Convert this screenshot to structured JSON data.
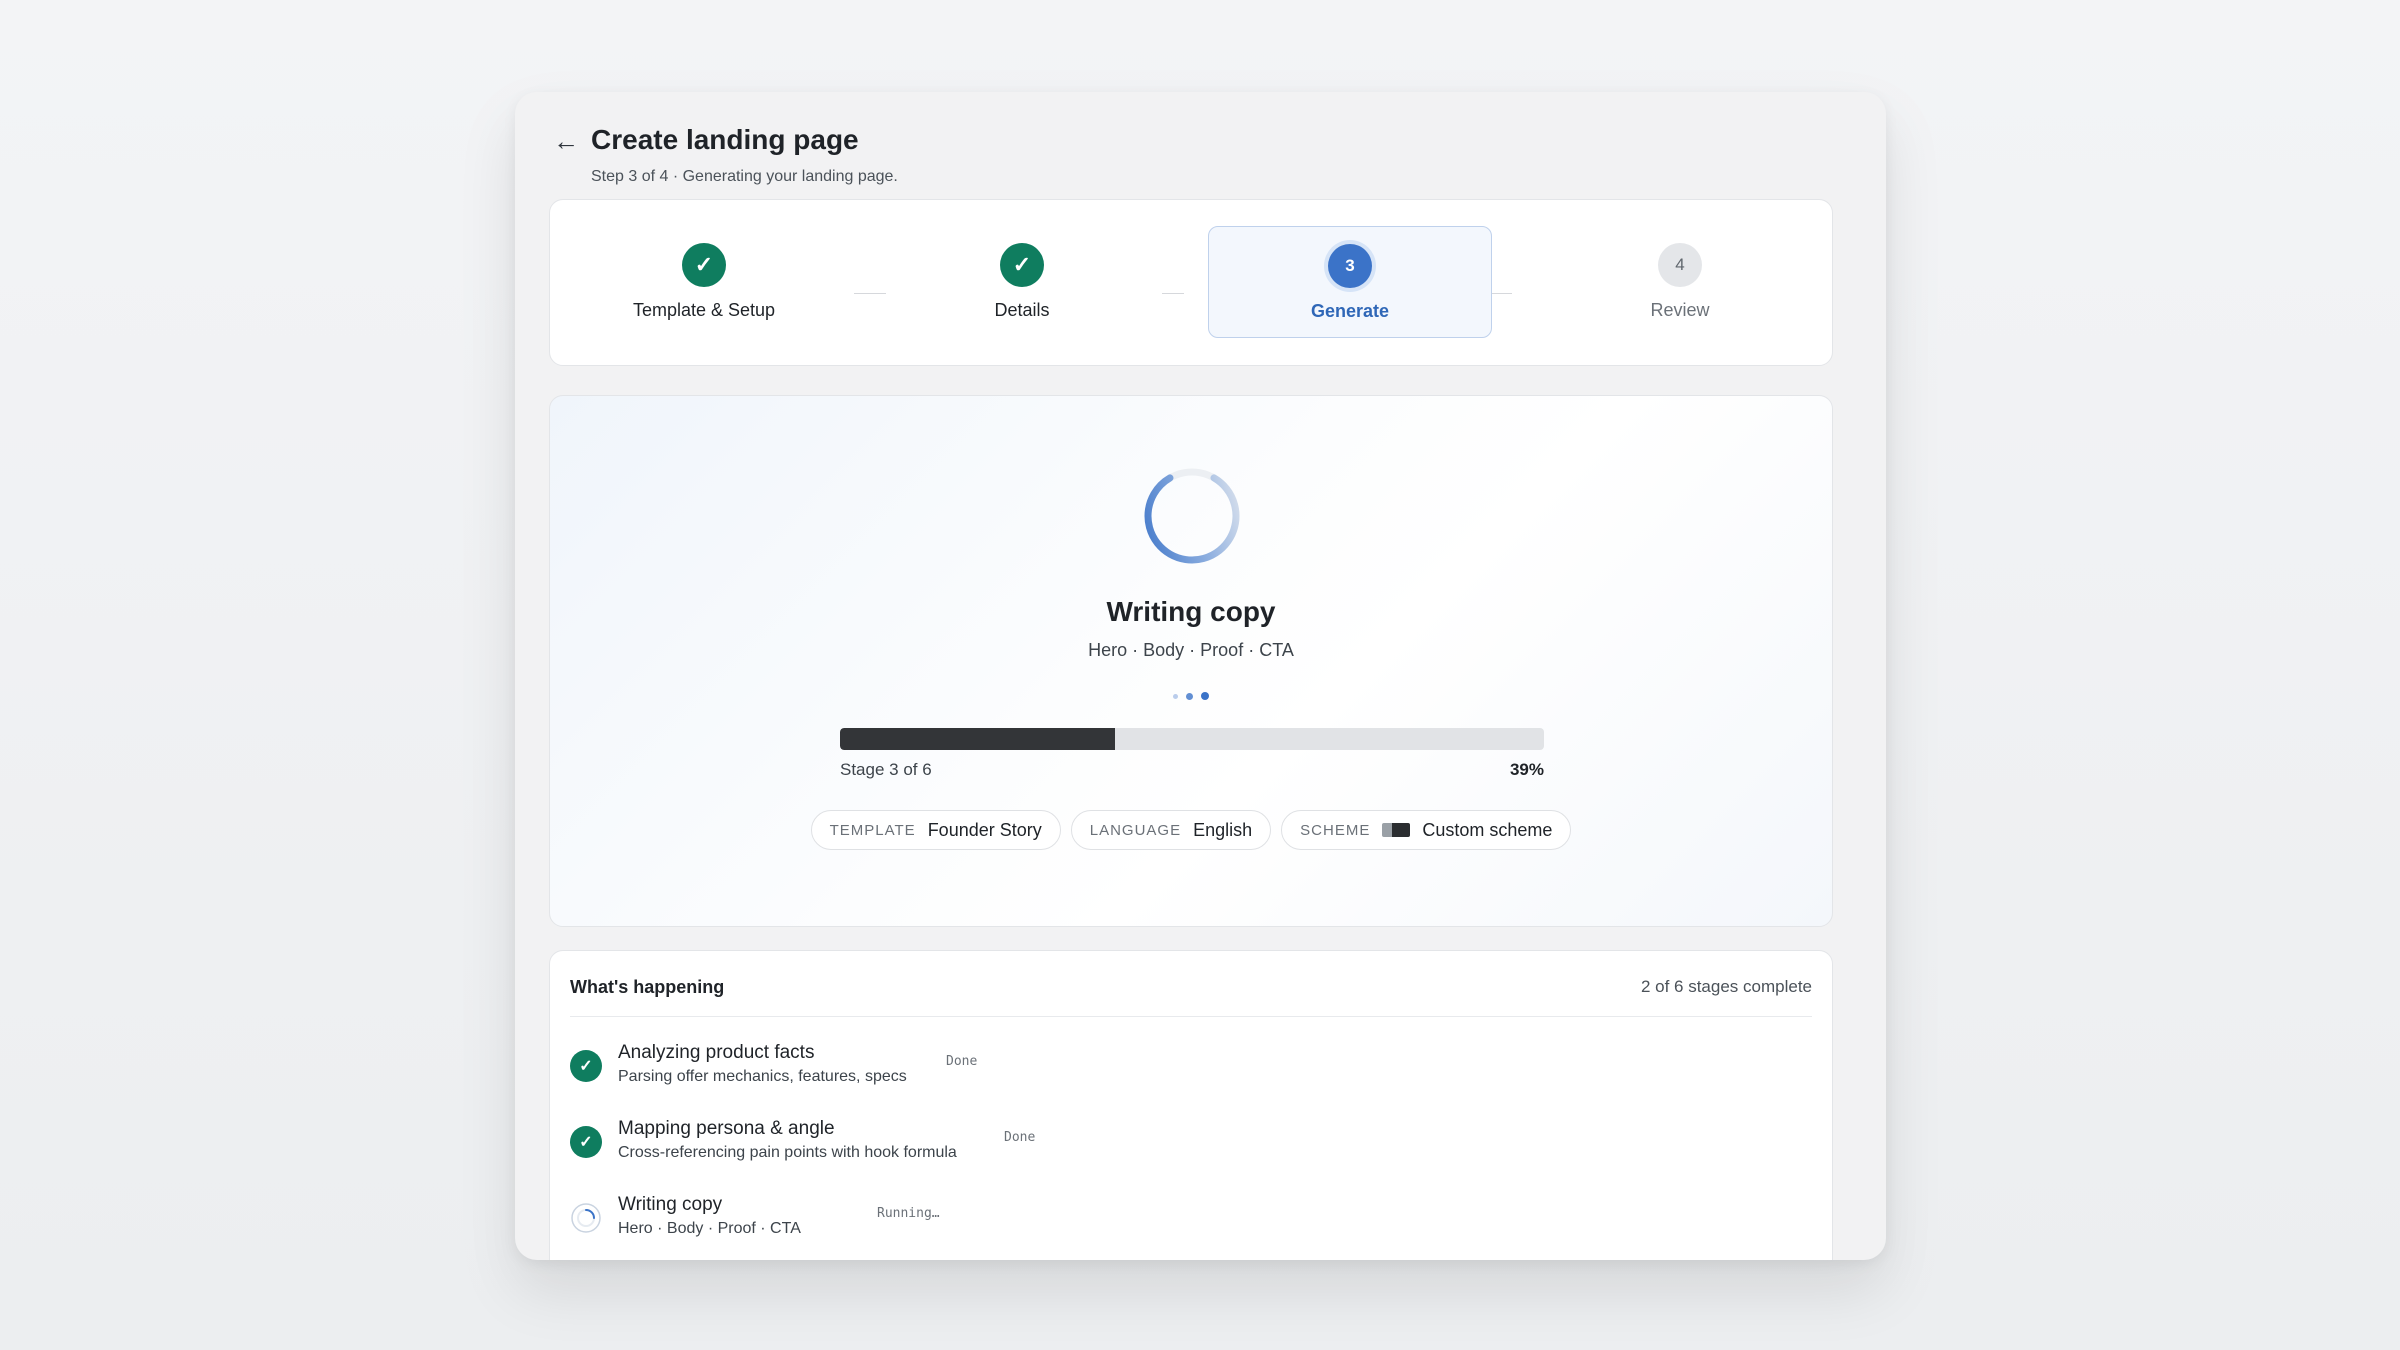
{
  "header": {
    "back_icon": "arrow-left-icon",
    "title": "Create landing page",
    "subtitle": "Step 3 of 4 · Generating your landing page."
  },
  "stepper": {
    "steps": [
      {
        "number": "1",
        "label": "Template & Setup",
        "state": "done",
        "icon": "check-icon"
      },
      {
        "number": "2",
        "label": "Details",
        "state": "done",
        "icon": "check-icon"
      },
      {
        "number": "3",
        "label": "Generate",
        "state": "active"
      },
      {
        "number": "4",
        "label": "Review",
        "state": "pending"
      }
    ]
  },
  "generation": {
    "spinner_icon": "loading-ring-icon",
    "title": "Writing copy",
    "subtitle": "Hero · Body · Proof · CTA",
    "progress_percent": 39,
    "progress_label": "39%",
    "stage_label": "Stage 3 of 6",
    "chips": [
      {
        "key": "TEMPLATE",
        "value": "Founder Story"
      },
      {
        "key": "LANGUAGE",
        "value": "English"
      },
      {
        "key": "SCHEME",
        "value": "Custom scheme",
        "swatch": [
          "#9aa0a6",
          "#2b2d30"
        ]
      }
    ]
  },
  "activity": {
    "heading": "What's happening",
    "count": "2 of 6 stages complete",
    "items": [
      {
        "name": "Analyzing product facts",
        "desc": "Parsing offer mechanics, features, specs",
        "status": "Done",
        "state": "done"
      },
      {
        "name": "Mapping persona & angle",
        "desc": "Cross-referencing pain points with hook formula",
        "status": "Done",
        "state": "done"
      },
      {
        "name": "Writing copy",
        "desc": "Hero · Body · Proof · CTA",
        "status": "Running…",
        "state": "running"
      }
    ]
  },
  "colors": {
    "accent": "#3b73c8",
    "success": "#0f7d5f",
    "progress_fill": "#333538"
  }
}
